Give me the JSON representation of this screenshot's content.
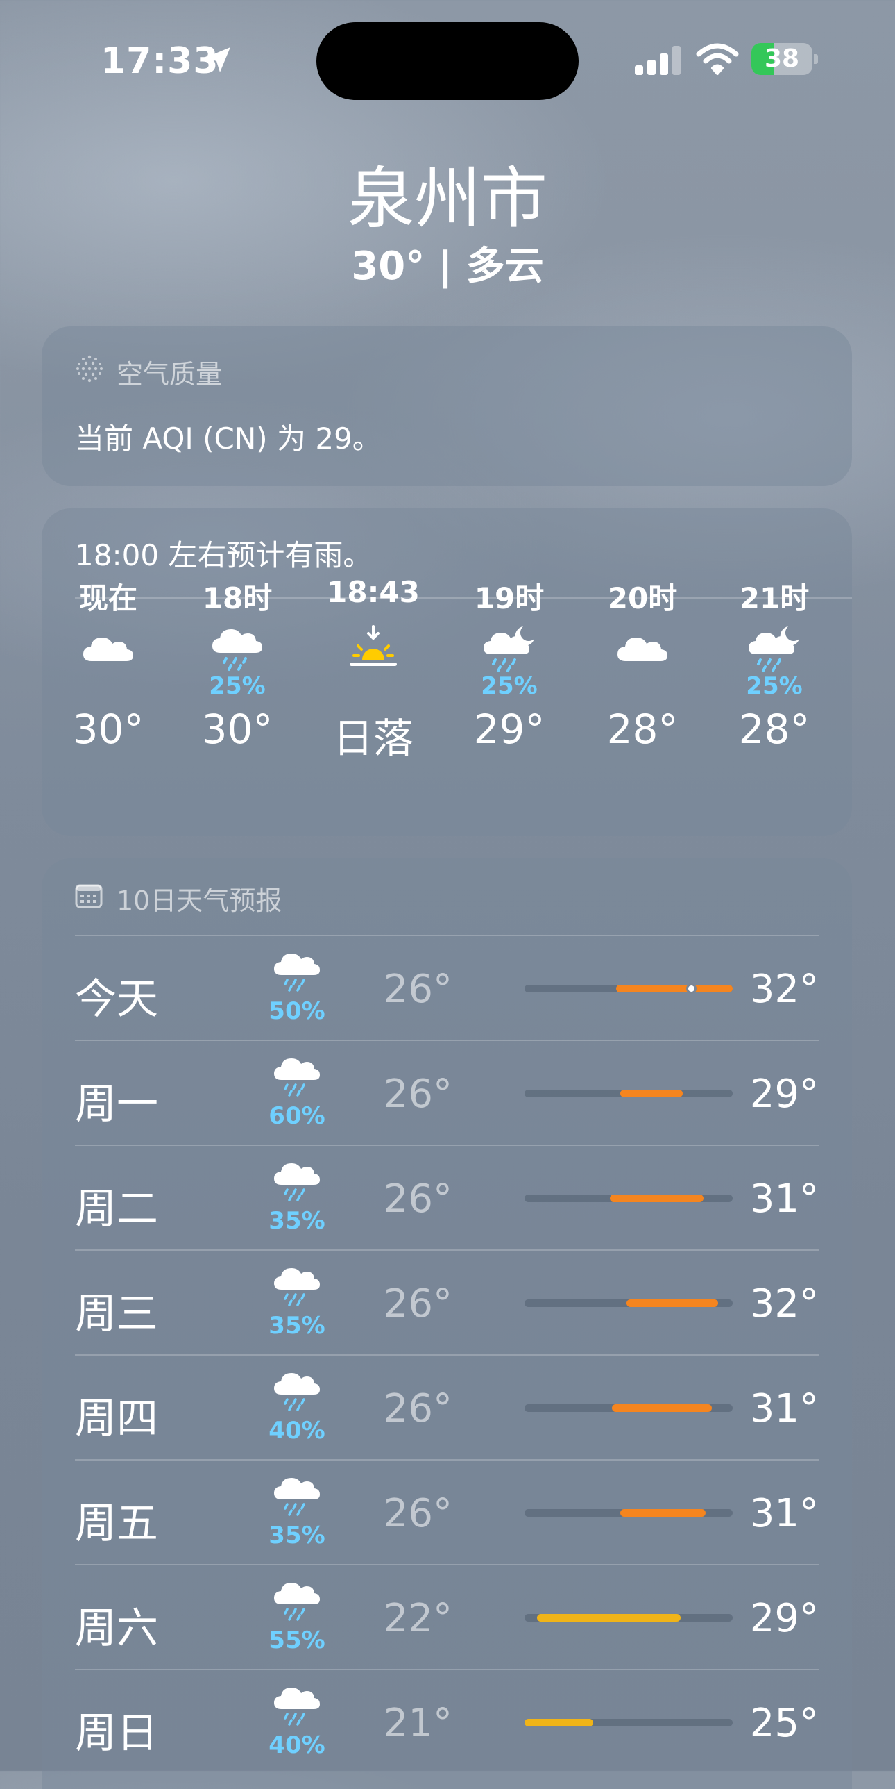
{
  "status_bar": {
    "time": "17:33",
    "battery": "38",
    "battery_level": 0.38,
    "battery_color": "#34c759",
    "icons": [
      "location-arrow-icon",
      "cellular-signal-icon",
      "wifi-icon",
      "battery-charging-icon"
    ]
  },
  "header": {
    "city": "泉州市",
    "summary": "30° | 多云"
  },
  "aqi_card": {
    "title": "空气质量",
    "text": "当前 AQI (CN) 为 29。",
    "icon": "air-quality-icon"
  },
  "hourly_card": {
    "note": "18:00 左右预计有雨。",
    "items": [
      {
        "label": "现在",
        "icon": "cloud-icon",
        "precip": "",
        "temp": "30°"
      },
      {
        "label": "18时",
        "icon": "cloud-rain-icon",
        "precip": "25%",
        "temp": "30°"
      },
      {
        "label": "18:43",
        "icon": "sunset-icon",
        "precip": "",
        "temp": "日落"
      },
      {
        "label": "19时",
        "icon": "cloud-moon-rain-icon",
        "precip": "25%",
        "temp": "29°"
      },
      {
        "label": "20时",
        "icon": "cloud-icon",
        "precip": "",
        "temp": "28°"
      },
      {
        "label": "21时",
        "icon": "cloud-moon-rain-icon",
        "precip": "25%",
        "temp": "28°"
      }
    ]
  },
  "daily_card": {
    "title": "10日天气预报",
    "icon": "calendar-icon",
    "range_bar_colors": {
      "warm": "#f5851f",
      "mild": "#f0b418",
      "track": "rgba(80,95,112,0.55)"
    },
    "days": [
      {
        "day": "今天",
        "icon": "cloud-rain-icon",
        "precip": "50%",
        "low": "26°",
        "high": "32°",
        "bar_start": 0.44,
        "bar_end": 1.0,
        "current_marker": 0.8,
        "bar_color": "warm"
      },
      {
        "day": "周一",
        "icon": "cloud-rain-icon",
        "precip": "60%",
        "low": "26°",
        "high": "29°",
        "bar_start": 0.46,
        "bar_end": 0.76,
        "bar_color": "warm"
      },
      {
        "day": "周二",
        "icon": "cloud-rain-icon",
        "precip": "35%",
        "low": "26°",
        "high": "31°",
        "bar_start": 0.41,
        "bar_end": 0.86,
        "bar_color": "warm"
      },
      {
        "day": "周三",
        "icon": "cloud-rain-icon",
        "precip": "35%",
        "low": "26°",
        "high": "32°",
        "bar_start": 0.49,
        "bar_end": 0.93,
        "bar_color": "warm"
      },
      {
        "day": "周四",
        "icon": "cloud-rain-icon",
        "precip": "40%",
        "low": "26°",
        "high": "31°",
        "bar_start": 0.42,
        "bar_end": 0.9,
        "bar_color": "warm"
      },
      {
        "day": "周五",
        "icon": "cloud-rain-icon",
        "precip": "35%",
        "low": "26°",
        "high": "31°",
        "bar_start": 0.46,
        "bar_end": 0.87,
        "bar_color": "warm"
      },
      {
        "day": "周六",
        "icon": "cloud-rain-icon",
        "precip": "55%",
        "low": "22°",
        "high": "29°",
        "bar_start": 0.06,
        "bar_end": 0.75,
        "bar_color": "mild"
      },
      {
        "day": "周日",
        "icon": "cloud-rain-icon",
        "precip": "40%",
        "low": "21°",
        "high": "25°",
        "bar_start": 0.0,
        "bar_end": 0.33,
        "bar_color": "mild"
      }
    ]
  }
}
